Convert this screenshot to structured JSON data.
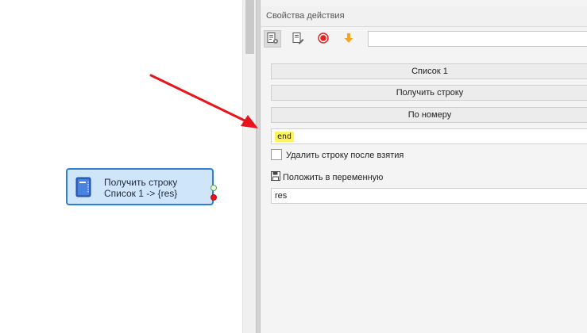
{
  "canvas": {
    "node": {
      "title": "Получить строку",
      "subtitle": "Список 1 -> {res}",
      "icon": "notebook-icon"
    }
  },
  "panel": {
    "title": "Свойства действия",
    "toolbar": {
      "input_value": "",
      "icons": [
        "properties-icon",
        "edit-icon",
        "record-icon",
        "arrow-down-icon"
      ]
    },
    "list_button": "Список 1",
    "action_button": "Получить строку",
    "mode_button": "По номеру",
    "number_value": "end",
    "delete_checkbox_label": "Удалить строку после взятия",
    "delete_checked": false,
    "save_label": "Положить в переменную",
    "variable_value": "res"
  },
  "colors": {
    "node_fill": "#cfe6fa",
    "node_border": "#2d7fd3",
    "annotation_arrow": "#e8141b",
    "highlight": "#fff35c"
  }
}
